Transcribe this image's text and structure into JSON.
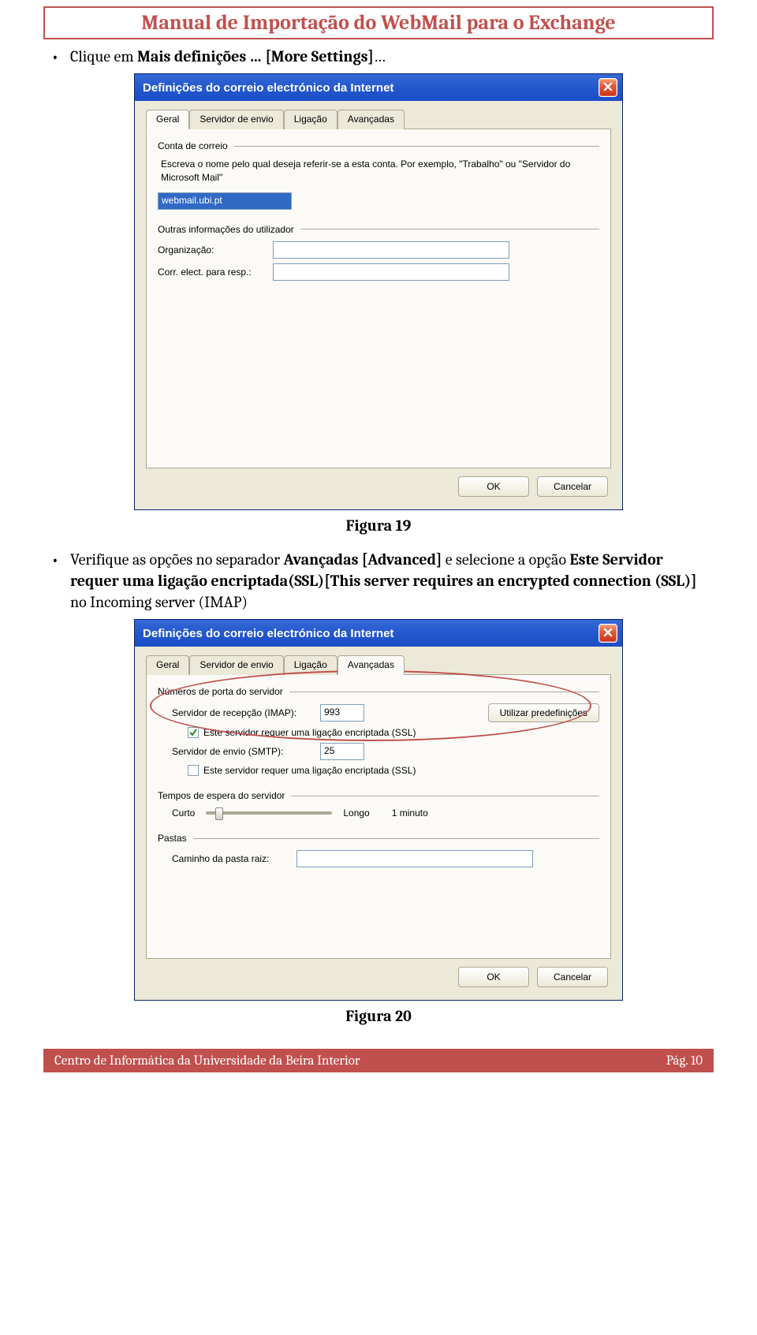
{
  "doc": {
    "title": "Manual de Importação do WebMail para o Exchange",
    "bullet1_pre": "Clique em ",
    "bullet1_bold": "Mais definições … [More Settings]",
    "bullet1_post": "…",
    "figure19": "Figura 19",
    "bullet2_pre": "Verifique as opções no separador  ",
    "bullet2_b1": "Avançadas  [Advanced]",
    "bullet2_mid": " e selecione a opção ",
    "bullet2_b2": "Este Servidor requer uma ligação encriptada(SSL)[This server requires an encrypted connection (SSL)]",
    "bullet2_post": " no Incoming server (IMAP)",
    "figure20": "Figura 20",
    "footer_left": "Centro de Informática da Universidade da Beira Interior",
    "footer_right_label": "Pág. ",
    "footer_right_num": "10"
  },
  "dlg1": {
    "title": "Definições do correio electrónico da Internet",
    "tabs": [
      "Geral",
      "Servidor de envio",
      "Ligação",
      "Avançadas"
    ],
    "legend1": "Conta de correio",
    "desc": "Escreva o nome pelo qual deseja referir-se a esta conta. Por exemplo, \"Trabalho\" ou \"Servidor do Microsoft Mail\"",
    "account_value": "webmail.ubi.pt",
    "legend2": "Outras informações do utilizador",
    "org_label": "Organização:",
    "reply_label": "Corr. elect. para resp.:",
    "ok": "OK",
    "cancel": "Cancelar"
  },
  "dlg2": {
    "title": "Definições do correio electrónico da Internet",
    "tabs": [
      "Geral",
      "Servidor de envio",
      "Ligação",
      "Avançadas"
    ],
    "legend_ports": "Números de porta do servidor",
    "imap_label": "Servidor de recepção (IMAP):",
    "imap_port": "993",
    "defaults_btn": "Utilizar predefinições",
    "ssl_checked": "Este servidor requer uma ligação encriptada (SSL)",
    "smtp_label": "Servidor de envio (SMTP):",
    "smtp_port": "25",
    "ssl_unchecked": "Este servidor requer uma ligação encriptada (SSL)",
    "legend_timeout": "Tempos de espera do servidor",
    "short": "Curto",
    "long": "Longo",
    "timeout_val": "1 minuto",
    "legend_folders": "Pastas",
    "root_label": "Caminho da pasta raiz:",
    "ok": "OK",
    "cancel": "Cancelar"
  }
}
